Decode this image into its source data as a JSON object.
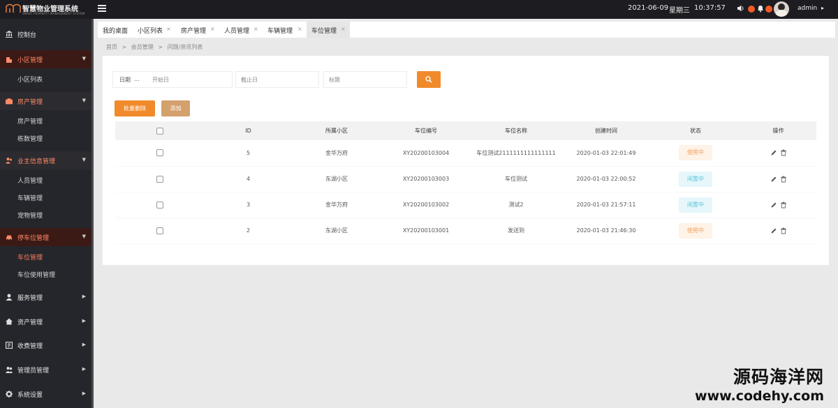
{
  "app": {
    "title": "智慧物业管理系统",
    "subtitle": "SMART PROPERTY MANAGEMENT SYSTEM"
  },
  "topbar": {
    "date": "2021-06-09",
    "weekday": "星期三",
    "time": "10:37:57",
    "user": "admin",
    "accent_color": "#f05a28"
  },
  "sidebar": {
    "dashboard": "控制台",
    "groups": [
      {
        "label": "小区管理",
        "icon": "building-icon",
        "open": true,
        "items": [
          "小区列表"
        ]
      },
      {
        "label": "房产管理",
        "icon": "briefcase-icon",
        "open": true,
        "items": [
          "房产管理",
          "栋数管理"
        ]
      },
      {
        "label": "业主信息管理",
        "icon": "users-icon",
        "open": true,
        "items": [
          "人员管理",
          "车辆管理",
          "宠物管理"
        ]
      },
      {
        "label": "停车位管理",
        "icon": "car-icon",
        "open": true,
        "items": [
          "车位管理",
          "车位使用管理"
        ]
      },
      {
        "label": "服务管理",
        "icon": "service-icon",
        "open": false,
        "items": []
      },
      {
        "label": "资产管理",
        "icon": "home-icon",
        "open": false,
        "items": []
      },
      {
        "label": "收费管理",
        "icon": "fee-icon",
        "open": false,
        "items": []
      },
      {
        "label": "管理员管理",
        "icon": "admin-icon",
        "open": false,
        "items": []
      },
      {
        "label": "系统设置",
        "icon": "gear-icon",
        "open": false,
        "items": []
      }
    ],
    "active_item": "车位管理"
  },
  "tabs": [
    {
      "label": "我的桌面",
      "closable": false
    },
    {
      "label": "小区列表",
      "closable": true
    },
    {
      "label": "房产管理",
      "closable": true
    },
    {
      "label": "人员管理",
      "closable": true
    },
    {
      "label": "车辆管理",
      "closable": true
    },
    {
      "label": "车位管理",
      "closable": true,
      "active": true
    }
  ],
  "tab_close_glyph": "×",
  "breadcrumb": [
    "首页",
    ">",
    "会员管理",
    ">",
    "问题/资讯列表"
  ],
  "filters": {
    "date_label": "日期",
    "start_placeholder": "开始日",
    "end_placeholder": "截止日",
    "title_placeholder": "标题"
  },
  "buttons": {
    "batch_delete": "批量删除",
    "add": "添加"
  },
  "table": {
    "headers": [
      "ID",
      "所属小区",
      "车位编号",
      "车位名称",
      "创建时间",
      "状态",
      "操作"
    ],
    "rows": [
      {
        "id": "5",
        "community": "金华万府",
        "code": "XY20200103004",
        "name": "车位测试2111111111111111",
        "created": "2020-01-03 22:01:49",
        "status": "使用中",
        "status_type": "busy"
      },
      {
        "id": "4",
        "community": "东湖小区",
        "code": "XY20200103003",
        "name": "车位测试",
        "created": "2020-01-03 22:00:52",
        "status": "闲置中",
        "status_type": "idle"
      },
      {
        "id": "3",
        "community": "金华万府",
        "code": "XY20200103002",
        "name": "测试2",
        "created": "2020-01-03 21:57:11",
        "status": "闲置中",
        "status_type": "idle"
      },
      {
        "id": "2",
        "community": "东湖小区",
        "code": "XY20200103001",
        "name": "发送到",
        "created": "2020-01-03 21:46:30",
        "status": "使用中",
        "status_type": "busy"
      }
    ]
  },
  "watermark": {
    "line1": "源码海洋网",
    "line2": "www.codehy.com"
  }
}
